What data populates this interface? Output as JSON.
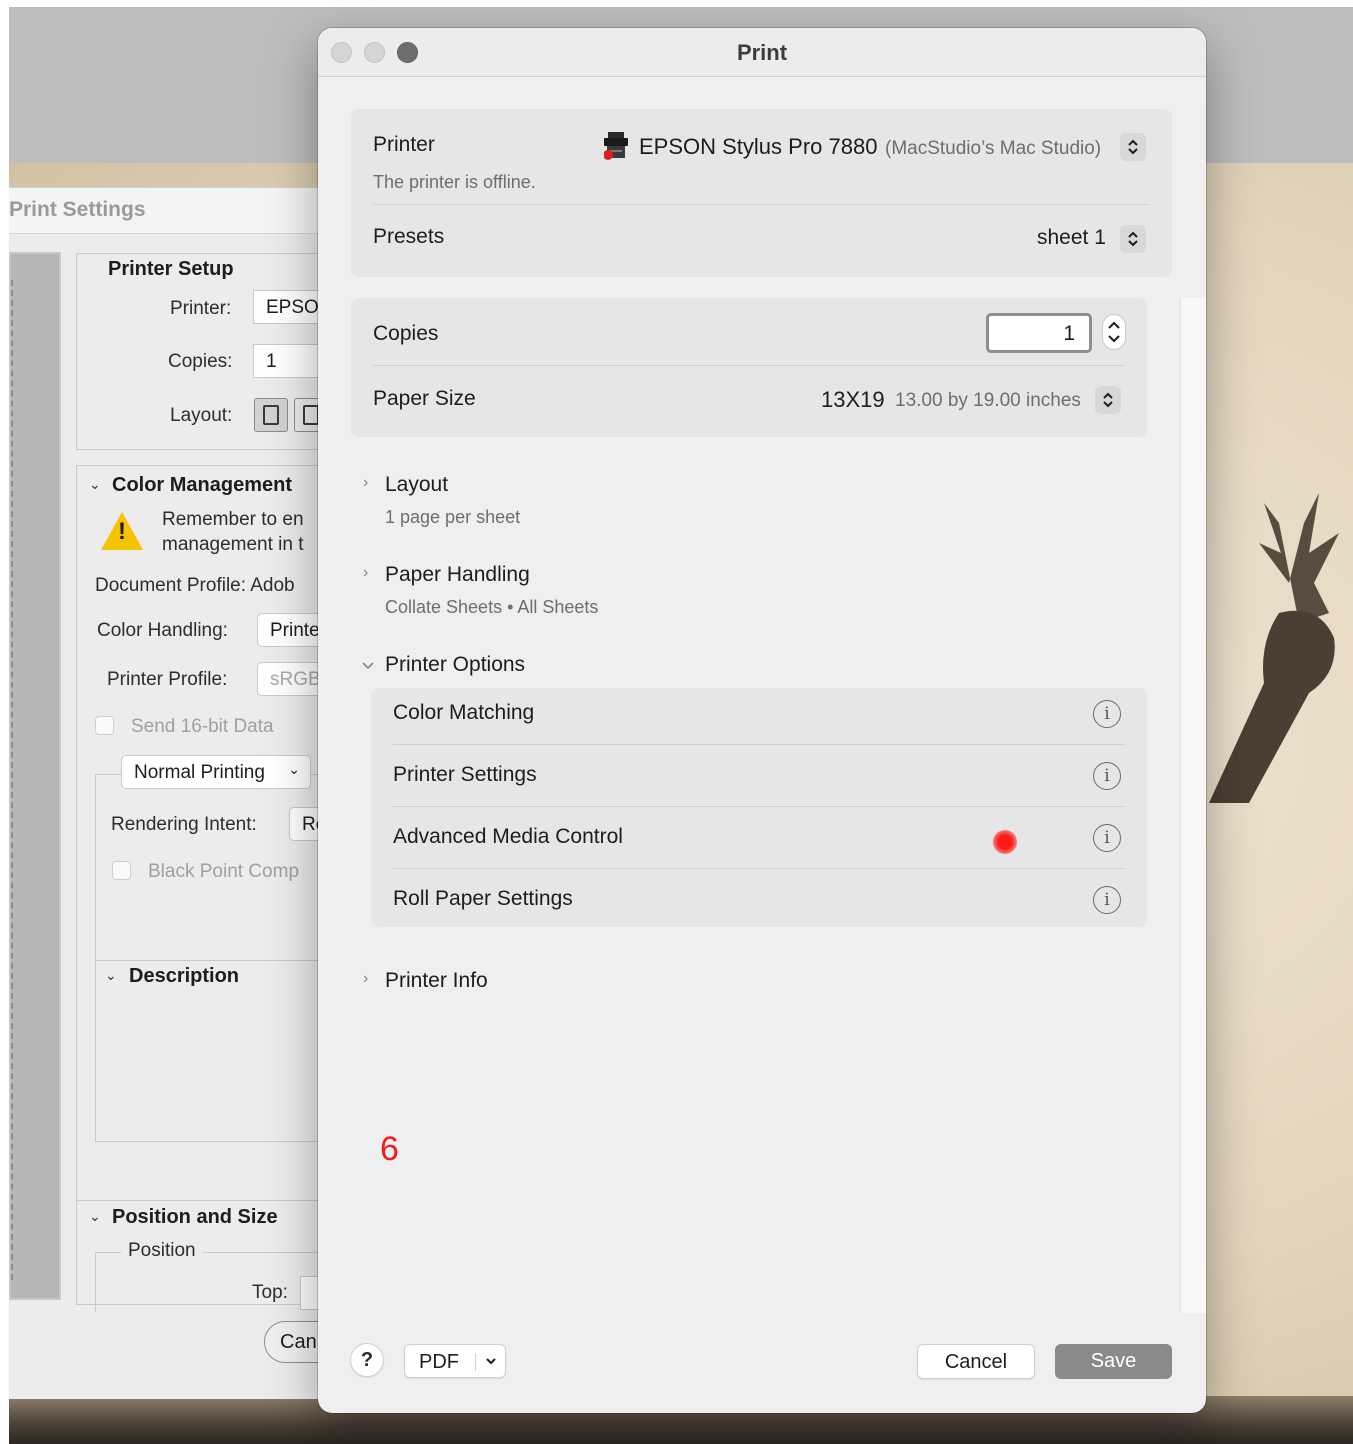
{
  "background_window": {
    "title": "Print Settings",
    "printer_setup": {
      "heading": "Printer Setup",
      "printer_label": "Printer:",
      "printer_value": "EPSO",
      "copies_label": "Copies:",
      "copies_value": "1",
      "layout_label": "Layout:"
    },
    "color_management": {
      "heading": "Color Management",
      "warning_line1": "Remember to en",
      "warning_line2": "management in t",
      "document_profile": "Document Profile: Adob",
      "color_handling_label": "Color Handling:",
      "color_handling_value": "Printe",
      "printer_profile_label": "Printer Profile:",
      "printer_profile_value": "sRGB",
      "send_16bit": "Send 16-bit Data",
      "mode_value": "Normal Printing",
      "rendering_intent_label": "Rendering Intent:",
      "rendering_intent_value": "Re",
      "black_point": "Black Point Comp"
    },
    "description_heading": "Description",
    "position_size": {
      "heading": "Position and Size",
      "position_label": "Position",
      "top_label": "Top:"
    },
    "cancel_label": "Can"
  },
  "dialog": {
    "title": "Print",
    "printer_label": "Printer",
    "printer_name": "EPSON Stylus Pro 7880",
    "printer_host": "(MacStudio’s Mac Studio)",
    "printer_status": "The printer is offline.",
    "presets_label": "Presets",
    "presets_value": "sheet 1",
    "copies_label": "Copies",
    "copies_value": "1",
    "paper_size_label": "Paper Size",
    "paper_size_value": "13X19",
    "paper_size_detail": "13.00 by 19.00 inches",
    "sections": [
      {
        "label": "Layout",
        "sub": "1 page per sheet",
        "expanded": false
      },
      {
        "label": "Paper Handling",
        "sub": "Collate Sheets • All Sheets",
        "expanded": false
      },
      {
        "label": "Printer Options",
        "sub": "",
        "expanded": true
      },
      {
        "label": "Printer Info",
        "sub": "",
        "expanded": false
      }
    ],
    "printer_options": [
      {
        "label": "Color Matching",
        "icon": "info-icon"
      },
      {
        "label": "Printer Settings",
        "icon": "info-icon"
      },
      {
        "label": "Advanced Media Control",
        "icon": "info-icon"
      },
      {
        "label": "Roll Paper Settings",
        "icon": "info-icon"
      }
    ],
    "annotation_number": "6",
    "help_label": "?",
    "pdf_label": "PDF",
    "cancel_label": "Cancel",
    "save_label": "Save"
  },
  "colors": {
    "dialog_bg": "#efefef",
    "card_bg": "#e6e6e8",
    "save_button": "#8a8a8a",
    "annotation_red": "#ee1c1c"
  }
}
